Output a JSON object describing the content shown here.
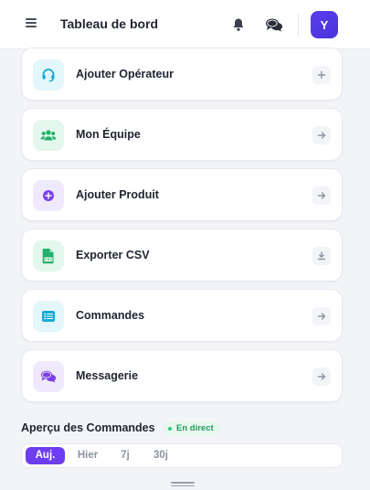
{
  "header": {
    "title": "Tableau de bord",
    "avatar_letter": "Y",
    "icons": [
      "menu-icon",
      "bell-icon",
      "chat-bubbles-icon"
    ]
  },
  "actions": [
    {
      "label": "Ajouter Opérateur",
      "icon": "headset-icon",
      "action_icon": "plus-icon",
      "icon_color": "#14a9d6",
      "icon_bg": "#e3f6fc"
    },
    {
      "label": "Mon Équipe",
      "icon": "users-icon",
      "action_icon": "arrow-right-icon",
      "icon_color": "#22b06b",
      "icon_bg": "#e4f7ee"
    },
    {
      "label": "Ajouter Produit",
      "icon": "plus-circle-icon",
      "action_icon": "arrow-right-icon",
      "icon_color": "#7a3fe8",
      "icon_bg": "#efe9fd"
    },
    {
      "label": "Exporter CSV",
      "icon": "csv-file-icon",
      "action_icon": "download-icon",
      "icon_color": "#22b06b",
      "icon_bg": "#e4f7ee"
    },
    {
      "label": "Commandes",
      "icon": "list-icon",
      "action_icon": "arrow-right-icon",
      "icon_color": "#14a9d6",
      "icon_bg": "#e3f6fc"
    },
    {
      "label": "Messagerie",
      "icon": "chat-icon",
      "action_icon": "arrow-right-icon",
      "icon_color": "#7a3fe8",
      "icon_bg": "#efe9fd"
    }
  ],
  "orders_overview": {
    "title": "Aperçu des Commandes",
    "badge": "En direct",
    "periods": [
      "Auj.",
      "Hier",
      "7j",
      "30j"
    ],
    "active_period": "Auj."
  },
  "colors": {
    "accent": "#6d3df0",
    "avatar": "#5a3df0",
    "live": "#1e9e5e"
  }
}
